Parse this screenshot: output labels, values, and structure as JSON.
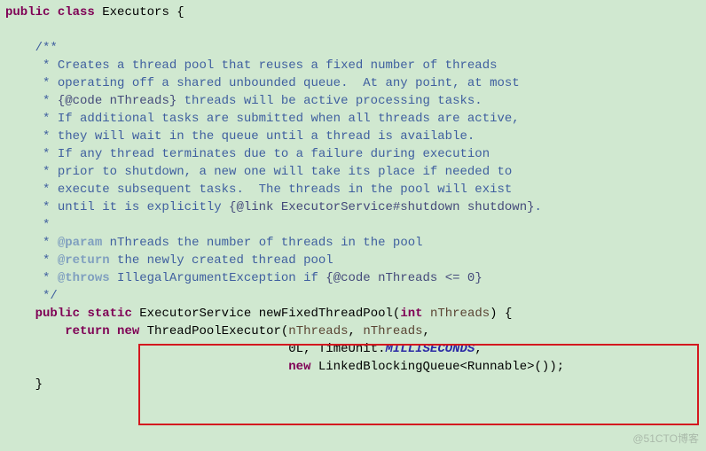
{
  "code": {
    "class_decl": {
      "mod1": "public",
      "mod2": "class",
      "name": "Executors",
      "open": " {"
    },
    "doc": {
      "open": "/**",
      "l1": " * Creates a thread pool that reuses a fixed number of threads",
      "l2": " * operating off a shared unbounded queue.  At any point, at most",
      "l3a": " * ",
      "l3code": "{@code nThreads}",
      "l3b": " threads will be active processing tasks.",
      "l4": " * If additional tasks are submitted when all threads are active,",
      "l5": " * they will wait in the queue until a thread is available.",
      "l6": " * If any thread terminates due to a failure during execution",
      "l7": " * prior to shutdown, a new one will take its place if needed to",
      "l8": " * execute subsequent tasks.  The threads in the pool will exist",
      "l9a": " * until it is explicitly ",
      "l9link": "{@link ExecutorService#shutdown shutdown}",
      "l9b": ".",
      "star": " *",
      "param_tag": "@param",
      "param_name": " nThreads",
      "param_desc": " the number of threads in the pool",
      "return_tag": "@return",
      "return_desc": " the newly created thread pool",
      "throws_tag": "@throws",
      "throws_name": " IllegalArgumentException",
      "throws_desc": " if ",
      "throws_code": "{@code nThreads <= 0}",
      "close": " */"
    },
    "method_sig": {
      "mod1": "public",
      "mod2": "static",
      "ret": " ExecutorService ",
      "name": "newFixedThreadPool",
      "open_p": "(",
      "ptype": "int",
      "pname": " nThreads",
      "close_p": ")",
      "brace": " {"
    },
    "body": {
      "ret_kw": "return",
      "new_kw": " new ",
      "ctor": "ThreadPoolExecutor",
      "openp": "(",
      "a1": "nThreads",
      "c1": ", ",
      "a2": "nThreads",
      "c2": ",",
      "line2_lead": "                                      ",
      "a3": "0L",
      "c3": ", ",
      "a4a": "TimeUnit.",
      "a4b": "MILLISECONDS",
      "c4": ",",
      "line3_lead": "                                      ",
      "new2": "new ",
      "a5": "LinkedBlockingQueue<Runnable>()",
      "close": ");"
    },
    "close_brace": "    }"
  },
  "indent": {
    "i1": "    ",
    "i2": "        ",
    "i3": "            "
  },
  "watermark": "@51CTO博客"
}
